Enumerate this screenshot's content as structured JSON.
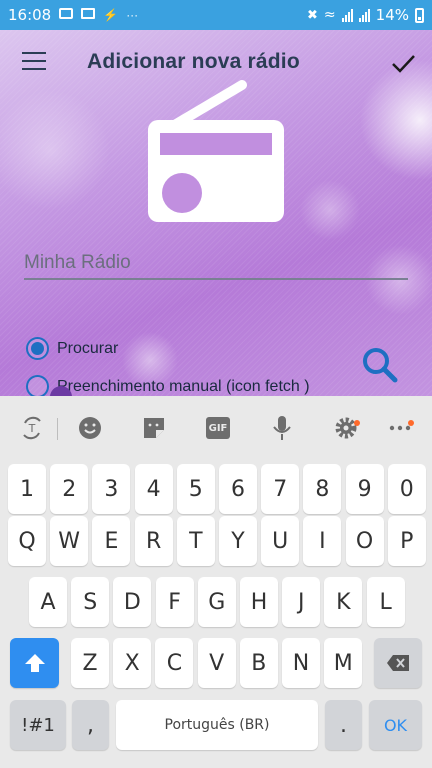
{
  "status_bar": {
    "time": "16:08",
    "battery": "14%"
  },
  "header": {
    "title": "Adicionar nova rádio",
    "menu_icon": "hamburger-menu-icon",
    "confirm_icon": "checkmark-icon"
  },
  "form": {
    "name_placeholder": "Minha Rádio",
    "name_value": "",
    "options": [
      {
        "label": "Procurar",
        "selected": true
      },
      {
        "label": "Preenchimento manual (icon fetch )",
        "selected": false
      }
    ],
    "search_icon": "search-icon"
  },
  "keyboard": {
    "toolbar": [
      "translate-icon",
      "emoji-icon",
      "sticker-icon",
      "gif-icon",
      "microphone-icon",
      "settings-icon",
      "more-icon"
    ],
    "gif_label": "GIF",
    "row_numbers": [
      "1",
      "2",
      "3",
      "4",
      "5",
      "6",
      "7",
      "8",
      "9",
      "0"
    ],
    "row_top": [
      "Q",
      "W",
      "E",
      "R",
      "T",
      "Y",
      "U",
      "I",
      "O",
      "P"
    ],
    "row_mid": [
      "A",
      "S",
      "D",
      "F",
      "G",
      "H",
      "J",
      "K",
      "L"
    ],
    "row_bottom": [
      "Z",
      "X",
      "C",
      "V",
      "B",
      "N",
      "M"
    ],
    "symbols_key": "!#1",
    "comma_key": ",",
    "space_label": "Português (BR)",
    "period_key": ".",
    "enter_label": "OK"
  }
}
